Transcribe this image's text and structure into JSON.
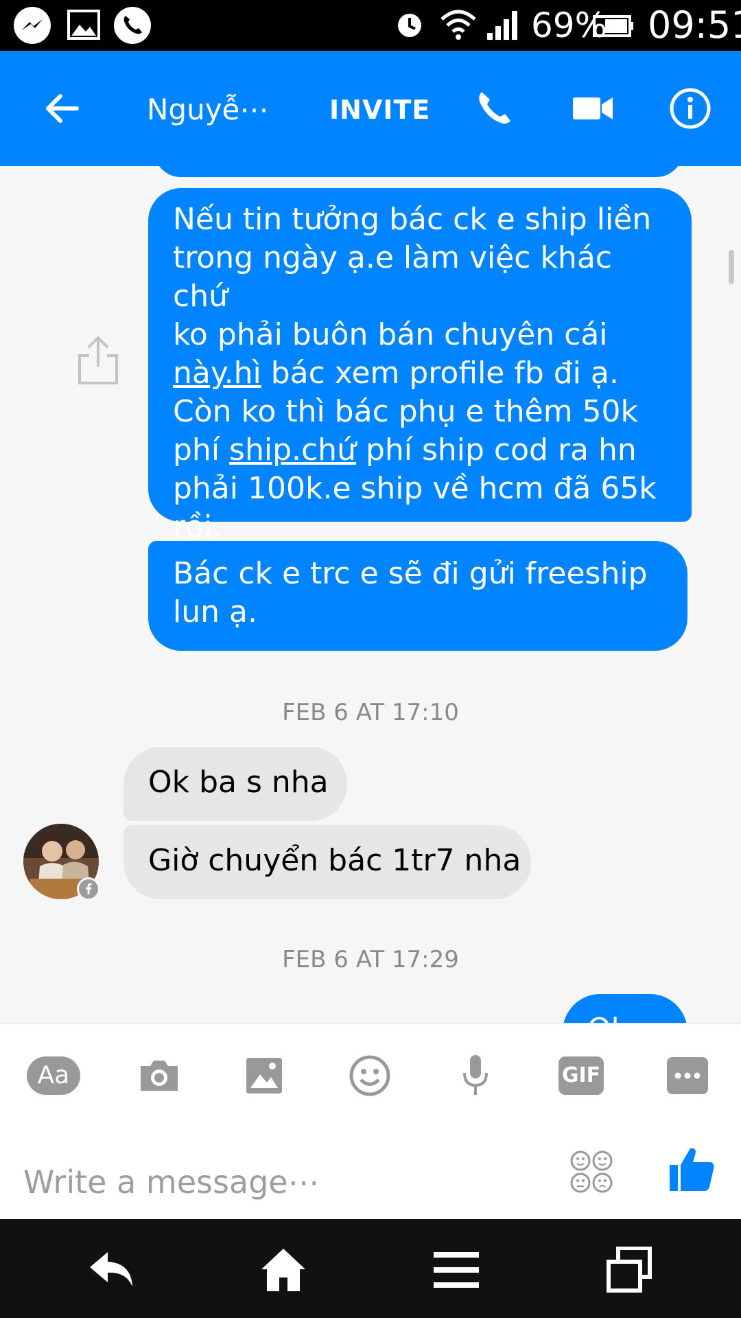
{
  "status_bar": {
    "notification_icons": [
      "messenger-icon",
      "image-icon",
      "phone-call-icon"
    ],
    "status_icons": [
      "alarm-icon",
      "wifi-icon",
      "signal-icon",
      "battery-icon"
    ],
    "battery": "69%",
    "time": "09:51"
  },
  "header": {
    "contact_name": "Nguyễ⋯",
    "invite_label": "INVITE",
    "icons": [
      "back-arrow-icon",
      "phone-icon",
      "video-camera-icon",
      "info-icon"
    ],
    "accent": "#0084ff"
  },
  "messages": {
    "out_1_lines": {
      "l1": "Nếu tin tưởng bác ck e ship liền",
      "l2": "trong ngày ạ.e làm việc khác chứ",
      "l3": "ko phải buôn bán chuyên cái",
      "l4_link": "này.hì",
      "l4_rest": " bác xem profile fb đi ạ.",
      "l5": "Còn ko thì bác phụ e thêm 50k",
      "l6_pre": "phí ",
      "l6_link": "ship.chứ",
      "l6_rest": " phí ship cod ra hn",
      "l7": "phải 100k.e ship về hcm đã 65k",
      "l8": "rồi."
    },
    "out_2_lines": {
      "l1": "Bác ck e trc e sẽ đi gửi freeship",
      "l2": "lun ạ."
    },
    "timestamp_1": "FEB 6 AT 17:10",
    "in_1": "Ok ba s nha",
    "in_2": "Giờ chuyển bác 1tr7 nha",
    "timestamp_2": "FEB 6 AT 17:29",
    "partial_out": "Ok"
  },
  "composer": {
    "tools": [
      "text-style-icon",
      "camera-icon",
      "gallery-icon",
      "emoji-icon",
      "microphone-icon",
      "gif-icon",
      "more-icon"
    ],
    "text_style_label": "Aa",
    "gif_label": "GIF",
    "placeholder": "Write a message⋯"
  },
  "nav_bar": {
    "icons": [
      "nav-back-icon",
      "nav-home-icon",
      "nav-menu-icon",
      "nav-recents-icon"
    ]
  }
}
